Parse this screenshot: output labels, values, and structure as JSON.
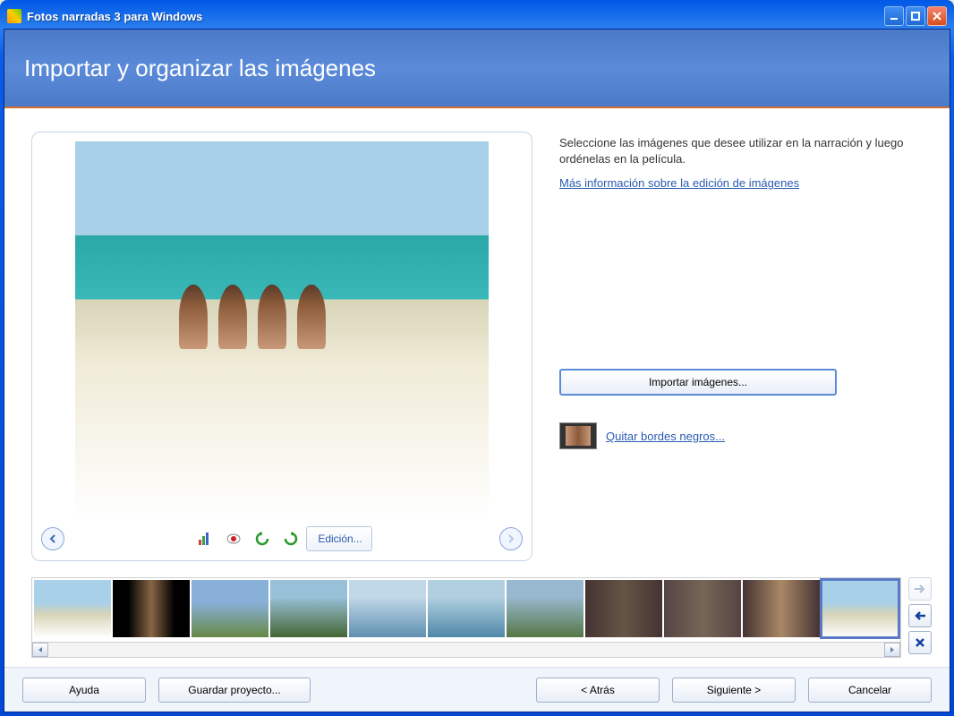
{
  "window": {
    "title": "Fotos narradas 3 para Windows"
  },
  "header": {
    "title": "Importar y organizar las imágenes"
  },
  "side": {
    "instruction": "Seleccione las imágenes que desee utilizar en la narración y luego ordénelas en la película.",
    "more_info_link": "Más información sobre la edición de imágenes",
    "import_button": "Importar imágenes...",
    "remove_borders_link": "Quitar bordes negros..."
  },
  "toolbar": {
    "edit_label": "Edición..."
  },
  "filmstrip": {
    "count": 11,
    "selected_index": 10
  },
  "footer": {
    "help": "Ayuda",
    "save": "Guardar proyecto...",
    "back": "< Atrás",
    "next": "Siguiente >",
    "cancel": "Cancelar"
  }
}
